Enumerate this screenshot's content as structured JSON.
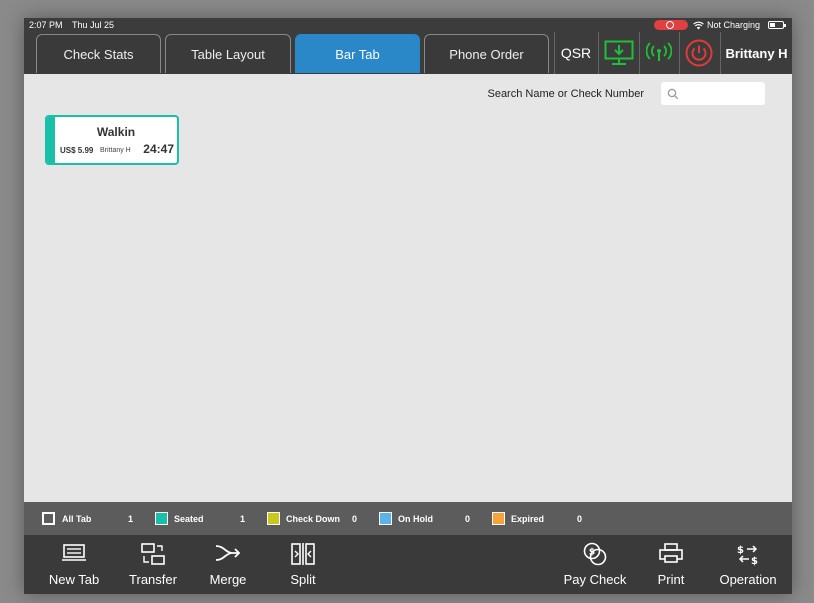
{
  "status_bar": {
    "time": "2:07 PM",
    "date": "Thu Jul 25",
    "charging": "Not Charging"
  },
  "nav": {
    "tabs": [
      {
        "label": "Check Stats",
        "active": false
      },
      {
        "label": "Table Layout",
        "active": false
      },
      {
        "label": "Bar Tab",
        "active": true
      },
      {
        "label": "Phone Order",
        "active": false
      }
    ],
    "qsr_label": "QSR",
    "user": "Brittany H"
  },
  "search": {
    "label": "Search Name or Check Number",
    "placeholder": ""
  },
  "tabs_list": [
    {
      "name": "Walkin",
      "amount": "US$ 5.99",
      "server": "Brittany H",
      "elapsed": "24:47",
      "status_color": "#1abfa8"
    }
  ],
  "legend": [
    {
      "label": "All Tab",
      "count": "1",
      "color": "#ffffff"
    },
    {
      "label": "Seated",
      "count": "1",
      "color": "#1abfa8"
    },
    {
      "label": "Check Down",
      "count": "0",
      "color": "#c8c81e"
    },
    {
      "label": "On Hold",
      "count": "0",
      "color": "#5ab4e8"
    },
    {
      "label": "Expired",
      "count": "0",
      "color": "#f7a23a"
    }
  ],
  "toolbar": {
    "new_tab": "New Tab",
    "transfer": "Transfer",
    "merge": "Merge",
    "split": "Split",
    "pay_check": "Pay Check",
    "print": "Print",
    "operation": "Operation"
  },
  "colors": {
    "active_tab": "#2a87c8",
    "accent_green": "#1fbf3a",
    "power_red": "#e03a3a"
  }
}
